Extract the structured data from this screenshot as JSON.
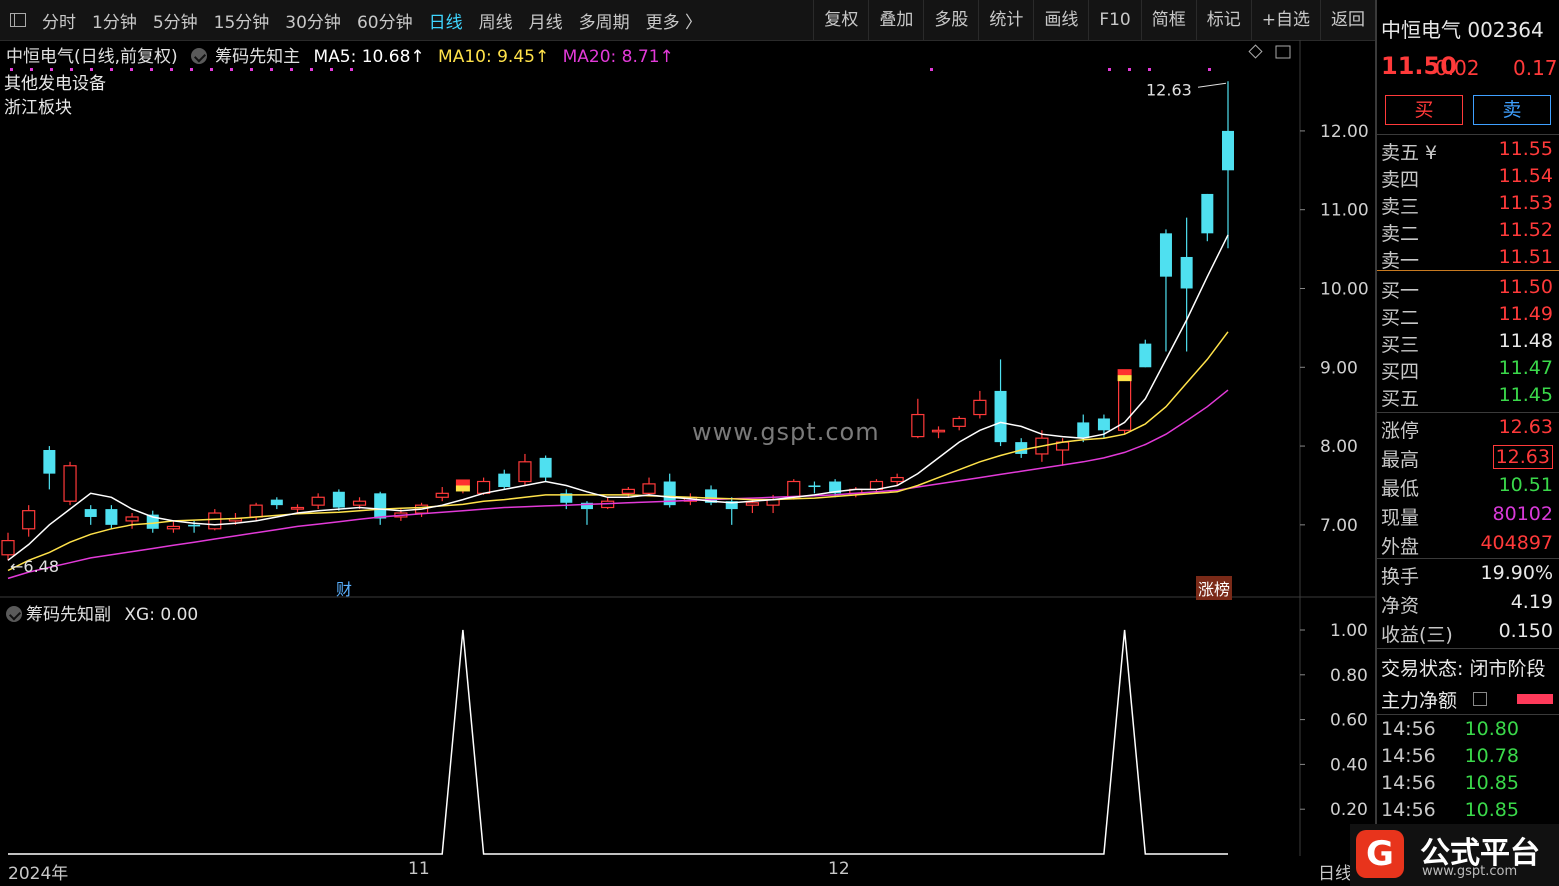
{
  "toolbar": {
    "tabs": [
      "分时",
      "1分钟",
      "5分钟",
      "15分钟",
      "30分钟",
      "60分钟",
      "日线",
      "周线",
      "月线",
      "多周期",
      "更多 〉"
    ],
    "active_tab": "日线",
    "right_tabs": [
      "复权",
      "叠加",
      "多股",
      "统计",
      "画线",
      "F10",
      "简框",
      "标记",
      "+自选",
      "返回"
    ]
  },
  "legend": {
    "title": "中恒电气(日线,前复权)",
    "indicator": "筹码先知主",
    "ma5": "MA5: 10.68↑",
    "ma10": "MA10: 9.45↑",
    "ma20": "MA20: 8.71↑",
    "colors": {
      "ma5": "#ffffff",
      "ma10": "#ffe24a",
      "ma20": "#e23ad8"
    }
  },
  "tags": [
    "其他发电设备",
    "浙江板块"
  ],
  "watermark": "www.gspt.com",
  "markers": {
    "cai": "财",
    "zhangbang": "涨榜",
    "high_label": "12.63",
    "low_label": "6.48"
  },
  "sub_legend": {
    "indicator": "筹码先知副",
    "xg": "XG: 0.00"
  },
  "dates": {
    "year": "2024年",
    "m11": "11",
    "m12": "12",
    "period": "日线"
  },
  "quote": {
    "name": "中恒电气 002364",
    "price": "11.50",
    "change": "0.02",
    "change_pct": "0.17",
    "buy_label": "买",
    "sell_label": "卖",
    "asks": [
      {
        "label": "卖五 ¥",
        "price": "11.55"
      },
      {
        "label": "卖四",
        "price": "11.54"
      },
      {
        "label": "卖三",
        "price": "11.53"
      },
      {
        "label": "卖二",
        "price": "11.52"
      },
      {
        "label": "卖一",
        "price": "11.51"
      }
    ],
    "bids": [
      {
        "label": "买一",
        "price": "11.50"
      },
      {
        "label": "买二",
        "price": "11.49"
      },
      {
        "label": "买三",
        "price": "11.48"
      },
      {
        "label": "买四",
        "price": "11.47"
      },
      {
        "label": "买五",
        "price": "11.45"
      }
    ],
    "stats": [
      {
        "label": "涨停",
        "value": "12.63"
      },
      {
        "label": "最高",
        "value": "12.63"
      },
      {
        "label": "最低",
        "value": "10.51"
      },
      {
        "label": "现量",
        "value": "80102"
      },
      {
        "label": "外盘",
        "value": "404897"
      }
    ],
    "stats2": [
      {
        "label": "换手",
        "value": "19.90%"
      },
      {
        "label": "净资",
        "value": "4.19"
      },
      {
        "label": "收益(三)",
        "value": "0.150"
      }
    ],
    "status_label": "交易状态: 闭市阶段",
    "main_net_label": "主力净额",
    "ticks": [
      {
        "time": "14:56",
        "price": "10.80"
      },
      {
        "time": "14:56",
        "price": "10.78"
      },
      {
        "time": "14:56",
        "price": "10.85"
      },
      {
        "time": "14:56",
        "price": "10.85"
      }
    ]
  },
  "logo": {
    "mark": "G",
    "text": "公式平台",
    "url_text": "www.gspt.com"
  },
  "chart_data": [
    {
      "type": "candlestick",
      "ylim": [
        6.3,
        12.9
      ],
      "yticks": [
        "12.00",
        "11.00",
        "10.00",
        "9.00",
        "8.00",
        "7.00"
      ],
      "candles": [
        [
          6.62,
          6.8,
          6.55,
          6.9
        ],
        [
          6.95,
          7.18,
          6.85,
          7.25
        ],
        [
          7.95,
          7.65,
          7.45,
          8.0
        ],
        [
          7.3,
          7.75,
          7.25,
          7.8
        ],
        [
          7.2,
          7.1,
          7.0,
          7.25
        ],
        [
          7.2,
          7.0,
          6.95,
          7.25
        ],
        [
          7.05,
          7.1,
          6.95,
          7.15
        ],
        [
          7.13,
          6.95,
          6.9,
          7.18
        ],
        [
          6.95,
          6.98,
          6.9,
          7.05
        ],
        [
          7.0,
          6.98,
          6.9,
          7.05
        ],
        [
          6.95,
          7.15,
          6.93,
          7.2
        ],
        [
          7.05,
          7.08,
          7.0,
          7.15
        ],
        [
          7.1,
          7.25,
          7.05,
          7.28
        ],
        [
          7.32,
          7.25,
          7.2,
          7.35
        ],
        [
          7.2,
          7.22,
          7.15,
          7.26
        ],
        [
          7.25,
          7.35,
          7.2,
          7.4
        ],
        [
          7.42,
          7.22,
          7.18,
          7.45
        ],
        [
          7.25,
          7.3,
          7.2,
          7.35
        ],
        [
          7.4,
          7.08,
          7.0,
          7.42
        ],
        [
          7.1,
          7.15,
          7.05,
          7.2
        ],
        [
          7.15,
          7.25,
          7.1,
          7.28
        ],
        [
          7.35,
          7.4,
          7.3,
          7.48
        ],
        [
          7.45,
          7.5,
          7.4,
          7.55
        ],
        [
          7.4,
          7.55,
          7.38,
          7.6
        ],
        [
          7.65,
          7.48,
          7.45,
          7.7
        ],
        [
          7.55,
          7.8,
          7.5,
          7.9
        ],
        [
          7.85,
          7.6,
          7.55,
          7.88
        ],
        [
          7.4,
          7.28,
          7.2,
          7.45
        ],
        [
          7.28,
          7.2,
          7.0,
          7.3
        ],
        [
          7.22,
          7.3,
          7.2,
          7.35
        ],
        [
          7.4,
          7.45,
          7.35,
          7.48
        ],
        [
          7.4,
          7.52,
          7.38,
          7.6
        ],
        [
          7.55,
          7.25,
          7.22,
          7.65
        ],
        [
          7.3,
          7.35,
          7.25,
          7.4
        ],
        [
          7.45,
          7.28,
          7.25,
          7.5
        ],
        [
          7.3,
          7.2,
          7.0,
          7.35
        ],
        [
          7.25,
          7.28,
          7.15,
          7.32
        ],
        [
          7.25,
          7.32,
          7.15,
          7.38
        ],
        [
          7.35,
          7.55,
          7.32,
          7.58
        ],
        [
          7.5,
          7.48,
          7.4,
          7.55
        ],
        [
          7.55,
          7.4,
          7.35,
          7.58
        ],
        [
          7.4,
          7.45,
          7.35,
          7.48
        ],
        [
          7.45,
          7.55,
          7.4,
          7.58
        ],
        [
          7.55,
          7.6,
          7.5,
          7.65
        ],
        [
          8.12,
          8.4,
          8.1,
          8.6
        ],
        [
          8.2,
          8.2,
          8.1,
          8.25
        ],
        [
          8.25,
          8.35,
          8.2,
          8.38
        ],
        [
          8.4,
          8.58,
          8.35,
          8.7
        ],
        [
          8.7,
          8.05,
          8.0,
          9.1
        ],
        [
          8.05,
          7.9,
          7.85,
          8.1
        ],
        [
          7.9,
          8.1,
          7.8,
          8.2
        ],
        [
          7.95,
          8.05,
          7.75,
          8.1
        ],
        [
          8.3,
          8.1,
          8.05,
          8.4
        ],
        [
          8.35,
          8.2,
          8.1,
          8.4
        ],
        [
          8.2,
          8.9,
          8.15,
          8.95
        ],
        [
          9.3,
          9.0,
          9.0,
          9.35
        ],
        [
          10.7,
          10.15,
          9.2,
          10.75
        ],
        [
          10.4,
          10.0,
          9.2,
          10.9
        ],
        [
          11.2,
          10.7,
          10.6,
          11.2
        ],
        [
          12.0,
          11.5,
          10.51,
          12.63
        ]
      ],
      "ma5": [
        6.55,
        6.75,
        7.0,
        7.2,
        7.4,
        7.35,
        7.2,
        7.1,
        7.05,
        7.02,
        7.0,
        7.02,
        7.05,
        7.1,
        7.15,
        7.18,
        7.2,
        7.22,
        7.2,
        7.18,
        7.2,
        7.25,
        7.32,
        7.4,
        7.45,
        7.5,
        7.55,
        7.5,
        7.42,
        7.35,
        7.35,
        7.38,
        7.35,
        7.33,
        7.3,
        7.28,
        7.3,
        7.32,
        7.35,
        7.38,
        7.42,
        7.45,
        7.45,
        7.5,
        7.65,
        7.85,
        8.05,
        8.2,
        8.3,
        8.25,
        8.15,
        8.12,
        8.1,
        8.15,
        8.3,
        8.6,
        9.1,
        9.6,
        10.15,
        10.68
      ],
      "ma10": [
        6.42,
        6.55,
        6.65,
        6.78,
        6.88,
        6.95,
        7.0,
        7.02,
        7.05,
        7.06,
        7.07,
        7.08,
        7.1,
        7.12,
        7.14,
        7.15,
        7.16,
        7.18,
        7.2,
        7.21,
        7.22,
        7.24,
        7.26,
        7.3,
        7.32,
        7.35,
        7.38,
        7.38,
        7.38,
        7.38,
        7.38,
        7.37,
        7.36,
        7.35,
        7.34,
        7.33,
        7.32,
        7.32,
        7.33,
        7.34,
        7.36,
        7.38,
        7.4,
        7.42,
        7.5,
        7.6,
        7.7,
        7.8,
        7.88,
        7.95,
        8.0,
        8.05,
        8.08,
        8.1,
        8.15,
        8.28,
        8.5,
        8.8,
        9.1,
        9.45
      ],
      "ma20": [
        6.32,
        6.4,
        6.46,
        6.52,
        6.58,
        6.62,
        6.66,
        6.7,
        6.74,
        6.78,
        6.82,
        6.86,
        6.9,
        6.94,
        6.98,
        7.01,
        7.04,
        7.07,
        7.1,
        7.12,
        7.14,
        7.16,
        7.18,
        7.2,
        7.22,
        7.23,
        7.24,
        7.25,
        7.26,
        7.27,
        7.28,
        7.29,
        7.3,
        7.31,
        7.32,
        7.33,
        7.34,
        7.35,
        7.36,
        7.37,
        7.38,
        7.4,
        7.42,
        7.44,
        7.48,
        7.52,
        7.56,
        7.6,
        7.64,
        7.68,
        7.72,
        7.76,
        7.8,
        7.85,
        7.92,
        8.02,
        8.15,
        8.32,
        8.5,
        8.71
      ]
    },
    {
      "type": "line",
      "ylim": [
        0,
        1.0
      ],
      "yticks": [
        "1.00",
        "0.80",
        "0.60",
        "0.40",
        "0.20"
      ],
      "values": [
        0,
        0,
        0,
        0,
        0,
        0,
        0,
        0,
        0,
        0,
        0,
        0,
        0,
        0,
        0,
        0,
        0,
        0,
        0,
        0,
        0,
        0,
        1,
        0,
        0,
        0,
        0,
        0,
        0,
        0,
        0,
        0,
        0,
        0,
        0,
        0,
        0,
        0,
        0,
        0,
        0,
        0,
        0,
        0,
        0,
        0,
        0,
        0,
        0,
        0,
        0,
        0,
        0,
        0,
        1,
        0,
        0,
        0,
        0,
        0
      ]
    }
  ]
}
